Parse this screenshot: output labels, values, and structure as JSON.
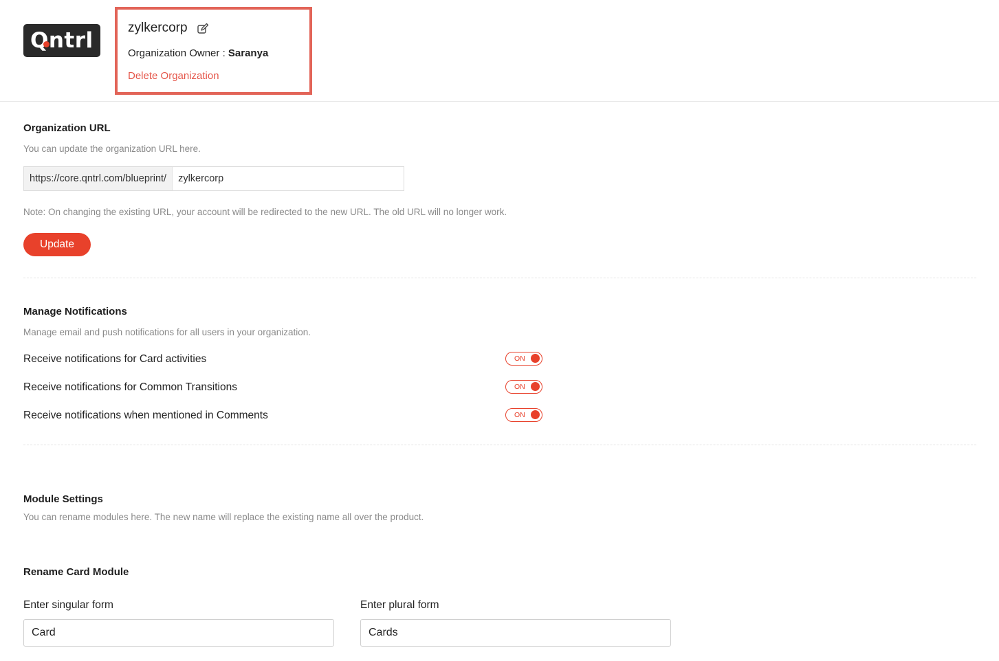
{
  "header": {
    "logo_text": "Qntrl",
    "org_name": "zylkercorp",
    "owner_label": "Organization Owner :",
    "owner_name": "Saranya",
    "delete_link": "Delete Organization",
    "edit_icon": "edit-icon"
  },
  "org_url": {
    "title": "Organization URL",
    "description": "You can update the organization URL here.",
    "prefix": "https://core.qntrl.com/blueprint/",
    "value": "zylkercorp",
    "note": "Note: On changing the existing URL, your account will be redirected to the new URL. The old URL will no longer work.",
    "update_button": "Update"
  },
  "notifications": {
    "title": "Manage Notifications",
    "description": "Manage email and push notifications for all users in your organization.",
    "items": [
      {
        "label": "Receive notifications for Card activities",
        "state": "ON"
      },
      {
        "label": "Receive notifications for Common Transitions",
        "state": "ON"
      },
      {
        "label": "Receive notifications when mentioned in Comments",
        "state": "ON"
      }
    ]
  },
  "module_settings": {
    "title": "Module Settings",
    "description": "You can rename modules here. The new name will replace the existing name all over the product.",
    "rename_title": "Rename Card Module",
    "singular_label": "Enter singular form",
    "singular_value": "Card",
    "plural_label": "Enter plural form",
    "plural_value": "Cards"
  },
  "colors": {
    "accent": "#e8412b",
    "highlight_border": "#e26458",
    "muted_text": "#8a8a8a"
  }
}
